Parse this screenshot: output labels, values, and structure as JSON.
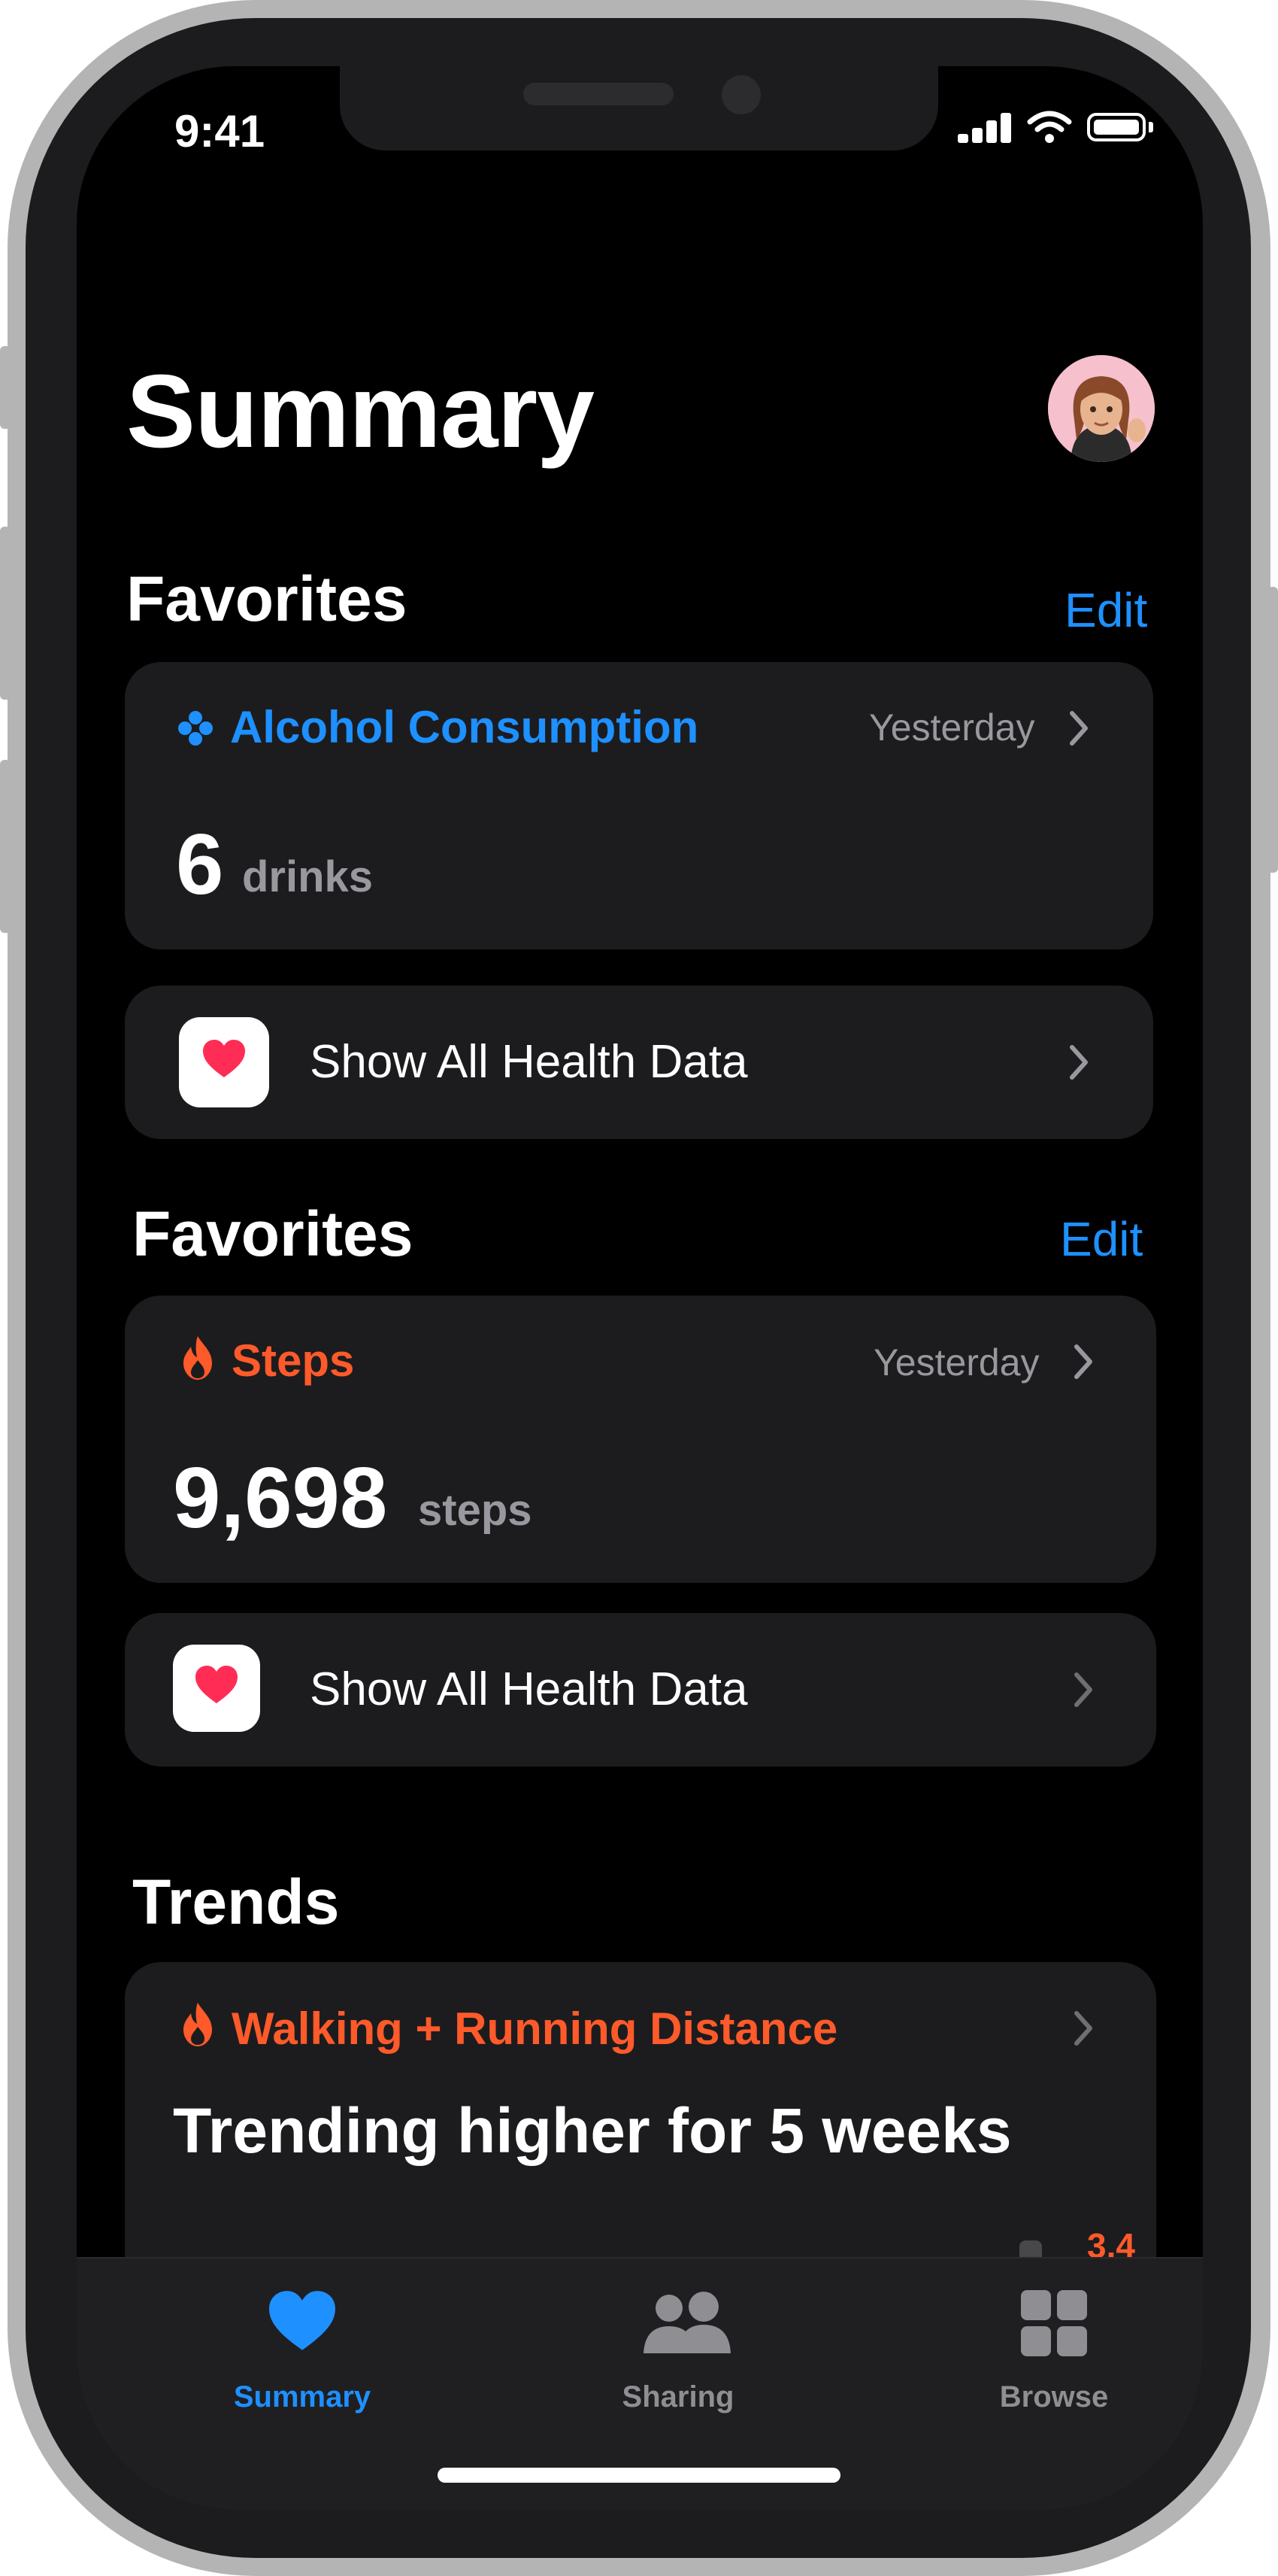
{
  "status_bar": {
    "time": "9:41"
  },
  "header": {
    "title": "Summary"
  },
  "favorites_1": {
    "title": "Favorites",
    "edit_label": "Edit",
    "metric_card": {
      "title": "Alcohol Consumption",
      "date": "Yesterday",
      "value": "6",
      "unit": "drinks",
      "color": "#1e90ff"
    },
    "show_all": {
      "label": "Show All Health Data"
    }
  },
  "favorites_2": {
    "title": "Favorites",
    "edit_label": "Edit",
    "metric_card": {
      "title": "Steps",
      "date": "Yesterday",
      "value": "9,698",
      "unit": "steps",
      "color": "#ff5a2a"
    },
    "show_all": {
      "label": "Show All Health Data"
    }
  },
  "trends": {
    "title": "Trends",
    "card": {
      "title": "Walking + Running Distance",
      "headline": "Trending higher for 5 weeks",
      "value_label": "3.4",
      "color": "#ff5a2a"
    }
  },
  "tabbar": {
    "tabs": [
      {
        "label": "Summary",
        "icon": "heart-icon",
        "active": true
      },
      {
        "label": "Sharing",
        "icon": "people-icon",
        "active": false
      },
      {
        "label": "Browse",
        "icon": "grid-icon",
        "active": false
      }
    ],
    "active_color": "#1e90ff",
    "inactive_color": "#8e8e93"
  }
}
